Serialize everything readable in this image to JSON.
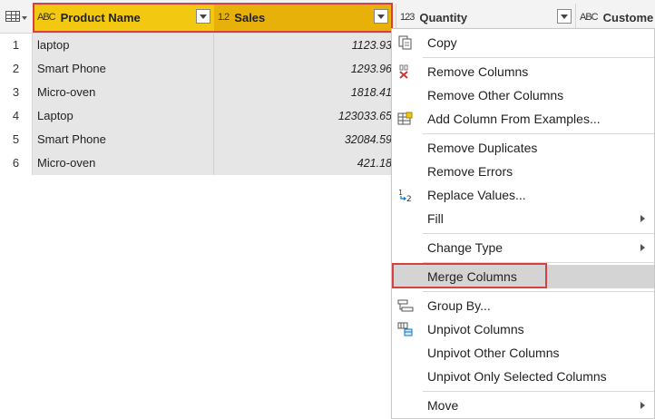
{
  "columns": [
    {
      "type_icon": "ABC",
      "name": "Product Name"
    },
    {
      "type_icon": "1.2",
      "name": "Sales"
    },
    {
      "type_icon": "123",
      "name": "Quantity"
    },
    {
      "type_icon": "ABC",
      "name": "Custome"
    }
  ],
  "rows": [
    {
      "num": "1",
      "product": "laptop",
      "sales": "1123.93"
    },
    {
      "num": "2",
      "product": "Smart Phone",
      "sales": "1293.96"
    },
    {
      "num": "3",
      "product": "Micro-oven",
      "sales": "1818.41"
    },
    {
      "num": "4",
      "product": "Laptop",
      "sales": "123033.65"
    },
    {
      "num": "5",
      "product": "Smart Phone",
      "sales": "32084.59"
    },
    {
      "num": "6",
      "product": "Micro-oven",
      "sales": "421.18"
    }
  ],
  "menu": {
    "copy": "Copy",
    "remove_columns": "Remove Columns",
    "remove_other_columns": "Remove Other Columns",
    "add_column_from_examples": "Add Column From Examples...",
    "remove_duplicates": "Remove Duplicates",
    "remove_errors": "Remove Errors",
    "replace_values": "Replace Values...",
    "fill": "Fill",
    "change_type": "Change Type",
    "merge_columns": "Merge Columns",
    "group_by": "Group By...",
    "unpivot_columns": "Unpivot Columns",
    "unpivot_other_columns": "Unpivot Other Columns",
    "unpivot_only_selected_columns": "Unpivot Only Selected Columns",
    "move": "Move"
  },
  "colors": {
    "selected_header": "#f2c811",
    "selected_header_alt": "#e7b10a",
    "highlight_border": "#d64040",
    "menu_hover": "#d4d4d4"
  }
}
